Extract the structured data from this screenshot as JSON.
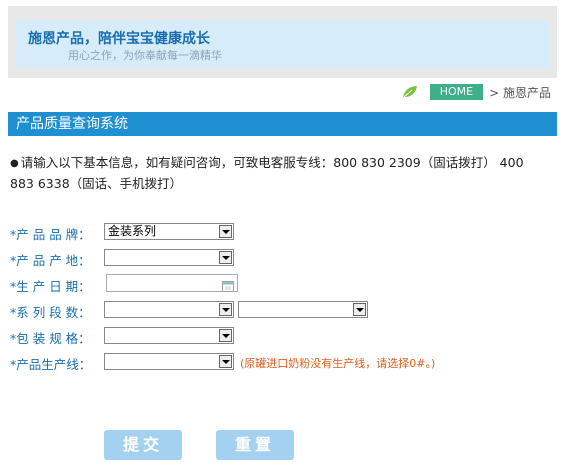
{
  "banner": {
    "title": "施恩产品，陪伴宝宝健康成长",
    "subtitle": "用心之作，为你奉献每一滴精华"
  },
  "breadcrumb": {
    "home": "HOME",
    "current": "> 施恩产品"
  },
  "section": {
    "title": "产品质量查询系统"
  },
  "notice": {
    "bullet": "●",
    "text": "请输入以下基本信息，如有疑问咨询，可致电客服专线：800 830 2309（固话拨打） 400 883 6338（固话、手机拨打）"
  },
  "form": {
    "brand_label": "*产 品 品 牌：",
    "brand_value": "金装系列",
    "origin_label": "*产 品 产 地：",
    "origin_value": "",
    "date_label": "*生 产 日 期：",
    "date_value": "",
    "series_label": "*系 列 段 数：",
    "series_value_1": "",
    "series_value_2": "",
    "spec_label": "*包 装 规 格：",
    "spec_value": "",
    "line_label": "*产品生产线：",
    "line_value": "",
    "line_hint": "(原罐进口奶粉没有生产线，请选择0#。)"
  },
  "buttons": {
    "submit": "提交",
    "reset": "重置"
  },
  "colors": {
    "section_bar": "#1e90d2",
    "banner_bg": "#d6edf9",
    "label": "#1a6eb0",
    "hint": "#e06020",
    "button": "#a4d1ef",
    "home_badge": "#3fae8a"
  },
  "icons": [
    "leaf-icon",
    "calendar-icon",
    "dropdown-arrow-icon"
  ]
}
